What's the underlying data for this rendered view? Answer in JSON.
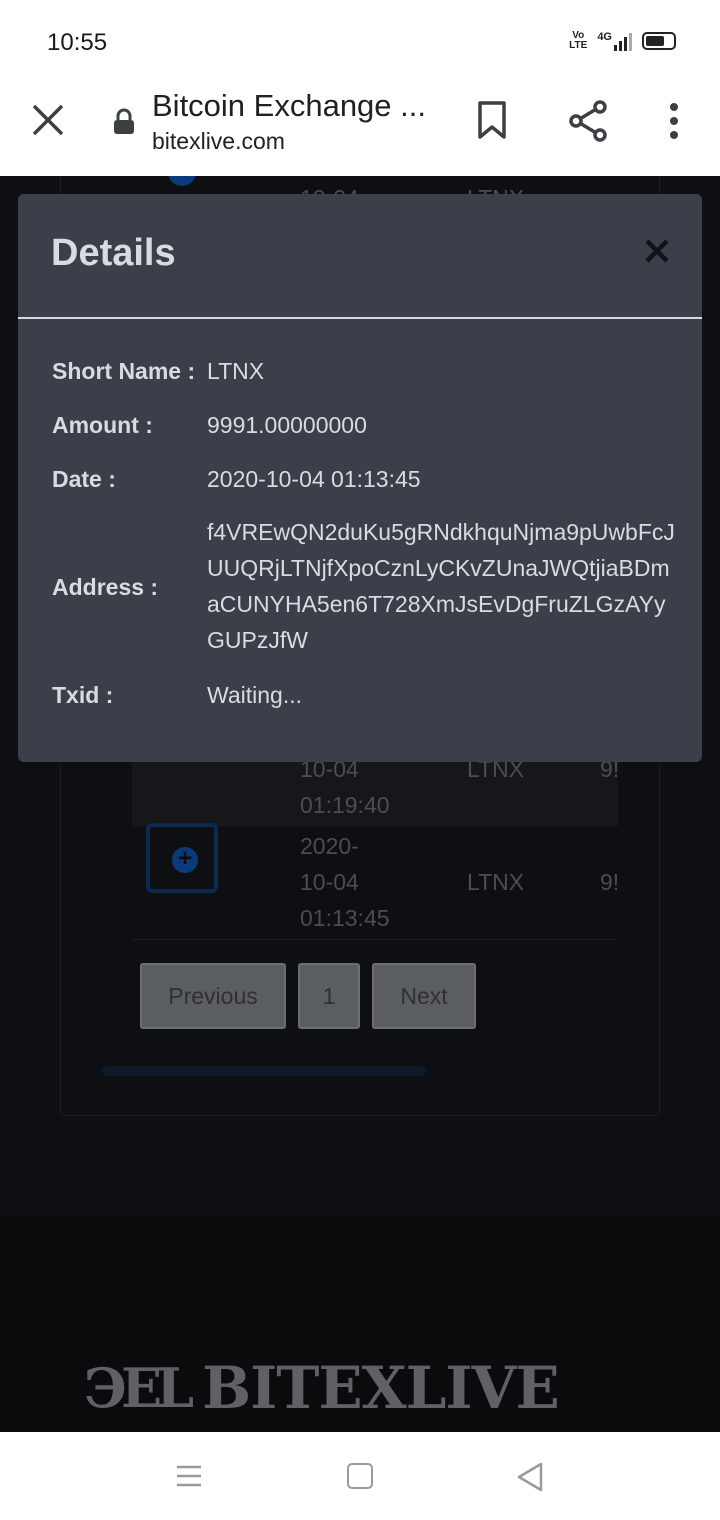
{
  "status_bar": {
    "time": "10:55",
    "network": "4G",
    "volte_top": "Vo",
    "volte_bottom": "LTE"
  },
  "browser": {
    "title": "Bitcoin Exchange ...",
    "url": "bitexlive.com"
  },
  "modal": {
    "title": "Details",
    "rows": [
      {
        "label": "Short Name :",
        "value": "LTNX"
      },
      {
        "label": "Amount :",
        "value": "9991.00000000"
      },
      {
        "label": "Date :",
        "value": "2020-10-04 01:13:45"
      },
      {
        "label": "Address :",
        "value": "f4VREwQN2duKu5gRNdkhquNjma9pUwbFcJUUQRjLTNjfXpoCznLyCKvZUnaJWQtjiaBDmaCUNYHA5en6T728XmJsEvDgFruZLGzAYyGUPzJfW"
      },
      {
        "label": "Txid :",
        "value": "Waiting..."
      }
    ]
  },
  "table": {
    "partial_row": {
      "date_line2": "10-04",
      "date_line3": "01:19:40",
      "coin": "LTNX",
      "amount_clip": "9!"
    },
    "row": {
      "date_line1": "2020-",
      "date_line2": "10-04",
      "date_line3": "01:13:45",
      "coin": "LTNX",
      "amount_clip": "9!"
    },
    "top_clip": {
      "date": "10-04",
      "coin": "LTNX"
    }
  },
  "pagination": {
    "previous": "Previous",
    "page": "1",
    "next": "Next"
  },
  "footer": {
    "logo_mark": "ЭEL",
    "logo_text": "BITEXLIVE"
  }
}
